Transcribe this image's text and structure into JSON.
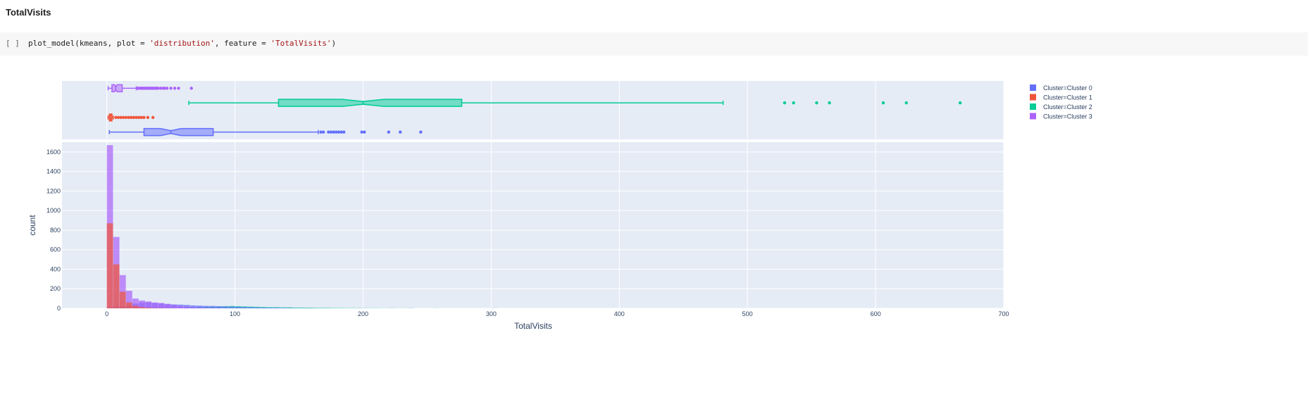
{
  "heading": "TotalVisits",
  "cell": {
    "run_label": "[ ]",
    "code_func": "plot_model(kmeans, plot = ",
    "code_plot_arg": "'distribution'",
    "code_mid": ", feature = ",
    "code_feature_arg": "'TotalVisits'",
    "code_end": ")"
  },
  "chart_data": {
    "type": "histogram",
    "xlabel": "TotalVisits",
    "ylabel": "count",
    "xlim": [
      -35,
      700
    ],
    "ylim": [
      0,
      1700
    ],
    "x_ticks": [
      0,
      100,
      200,
      300,
      400,
      500,
      600,
      700
    ],
    "y_ticks": [
      0,
      200,
      400,
      600,
      800,
      1000,
      1200,
      1400,
      1600
    ],
    "grid": true,
    "legend_position": "top-right",
    "bin_width": 5,
    "series": [
      {
        "name": "Cluster=Cluster 0",
        "color": "#636efa",
        "box": {
          "lower_fence": 2,
          "q1": 29,
          "median": 50,
          "q3": 83,
          "upper_fence": 165,
          "notch": [
            42,
            58
          ],
          "outliers": [
            167,
            169,
            173,
            175,
            177,
            179,
            181,
            183,
            185,
            199,
            201,
            220,
            229,
            245
          ]
        },
        "bins_start": 0,
        "counts": [
          12,
          18,
          20,
          28,
          48,
          60,
          62,
          55,
          50,
          45,
          40,
          38,
          35,
          30,
          28,
          25,
          24,
          22,
          20,
          18,
          16,
          14,
          12,
          10,
          8,
          7,
          6,
          5,
          4,
          3,
          2,
          2,
          1,
          1,
          1,
          0,
          0,
          0,
          0,
          1,
          1,
          0,
          0,
          0,
          1,
          0,
          0,
          1
        ]
      },
      {
        "name": "Cluster=Cluster 1",
        "color": "#ef553b",
        "box": {
          "lower_fence": 1,
          "q1": 2,
          "median": 3,
          "q3": 4,
          "upper_fence": 5,
          "notch": [
            2.5,
            3.5
          ],
          "outliers": [
            7,
            9,
            11,
            13,
            15,
            17,
            19,
            21,
            23,
            25,
            27,
            29,
            32,
            36
          ]
        },
        "bins_start": 0,
        "counts": [
          870,
          450,
          170,
          60,
          25,
          12,
          6,
          3,
          2,
          1
        ]
      },
      {
        "name": "Cluster=Cluster 2",
        "color": "#00cc96",
        "box": {
          "lower_fence": 64,
          "q1": 134,
          "median": 200,
          "q3": 277,
          "upper_fence": 481,
          "notch": [
            184,
            216
          ],
          "outliers": [
            529,
            536,
            554,
            564,
            606,
            624,
            666
          ]
        },
        "bins_start": 60,
        "counts": [
          10,
          12,
          14,
          16,
          18,
          20,
          22,
          24,
          22,
          20,
          18,
          16,
          14,
          12,
          12,
          10,
          10,
          8,
          8,
          7,
          6,
          5,
          5,
          4,
          4,
          3,
          3,
          2,
          2,
          2,
          2,
          1,
          1,
          1,
          1,
          1,
          0,
          0,
          0,
          1,
          0,
          0,
          0,
          0,
          0,
          0,
          0,
          0,
          1
        ]
      },
      {
        "name": "Cluster=Cluster 3",
        "color": "#ab63fa",
        "box": {
          "lower_fence": 1,
          "q1": 4,
          "median": 7,
          "q3": 12,
          "upper_fence": 23,
          "notch": [
            6,
            8
          ],
          "outliers": [
            24,
            25,
            26,
            27,
            28,
            29,
            30,
            31,
            32,
            33,
            34,
            35,
            36,
            37,
            38,
            39,
            40,
            42,
            44,
            45,
            47,
            50,
            53,
            56,
            66
          ]
        },
        "bins_start": 0,
        "counts": [
          1670,
          730,
          340,
          180,
          100,
          80,
          70,
          60,
          55,
          45,
          35,
          25,
          18,
          12,
          8,
          5,
          3,
          2,
          1
        ]
      }
    ]
  }
}
